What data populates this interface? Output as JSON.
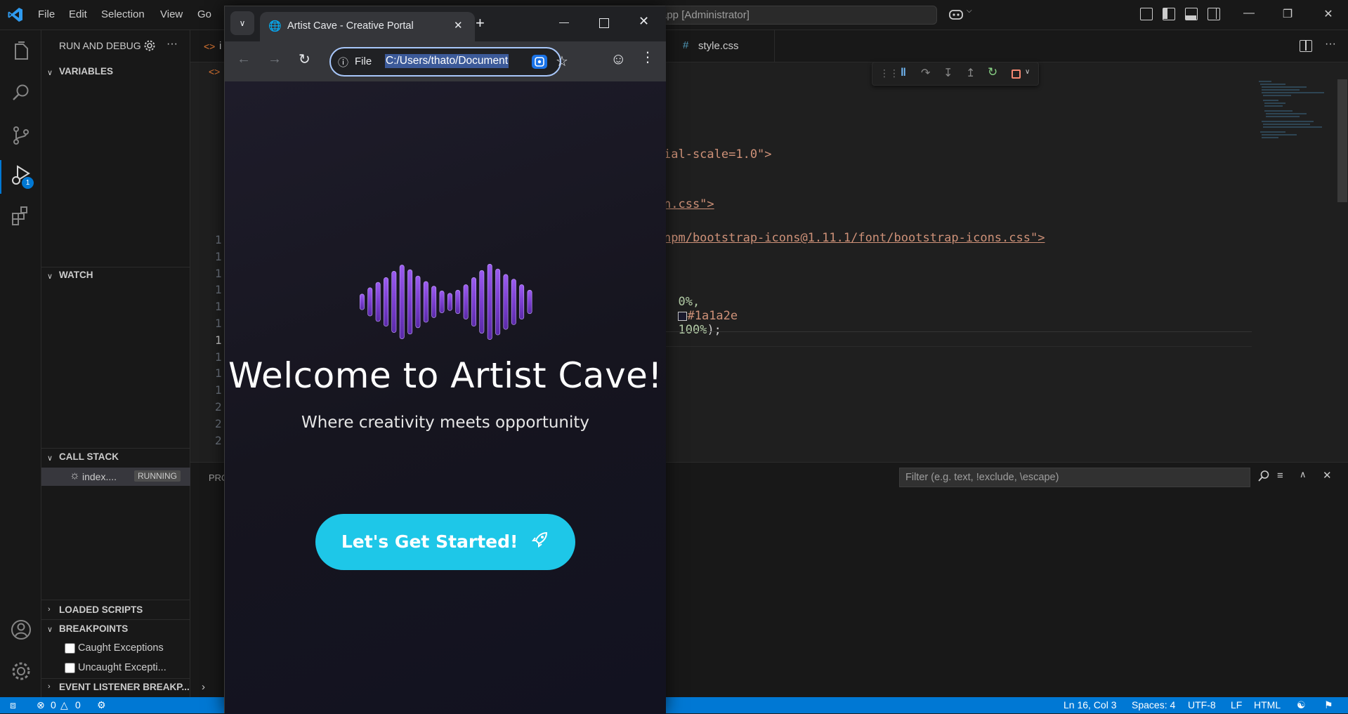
{
  "titlebar": {
    "menu": [
      "File",
      "Edit",
      "Selection",
      "View",
      "Go"
    ],
    "command_center": "app [Administrator]"
  },
  "activity": {
    "debug_badge": "1"
  },
  "sidebar": {
    "header": "RUN AND DEBUG",
    "variables": "VARIABLES",
    "watch": "WATCH",
    "call_stack": "CALL STACK",
    "call_stack_item": "index....",
    "call_stack_status": "RUNNING",
    "loaded_scripts": "LOADED SCRIPTS",
    "breakpoints": "BREAKPOINTS",
    "bp_caught": "Caught Exceptions",
    "bp_uncaught": "Uncaught Excepti...",
    "event_listener": "EVENT LISTENER BREAKP..."
  },
  "editor": {
    "tab_left": "i",
    "tab_style": "style.css",
    "line_numbers": [
      "1",
      "1",
      "1",
      "1",
      "1",
      "1",
      "1",
      "1",
      "1",
      "1",
      "2",
      "2",
      "2"
    ],
    "code": {
      "line_scale": "ial-scale=1.0\">",
      "line_css": "n.css\">",
      "line_icons": "npm/bootstrap-icons@1.11.1/font/bootstrap-icons.css\">",
      "line_gradient_a": "0%,",
      "line_gradient_b": "#1a1a2e",
      "line_gradient_c": "100%",
      "line_gradient_d": ");"
    }
  },
  "panel": {
    "tab_label": "PRO",
    "filter_placeholder": "Filter (e.g. text, !exclude, \\escape)"
  },
  "statusbar": {
    "errors": "0",
    "warnings": "0",
    "position": "Ln 16, Col 3",
    "spaces": "Spaces: 4",
    "encoding": "UTF-8",
    "eol": "LF",
    "language": "HTML"
  },
  "browser": {
    "tab_title": "Artist Cave - Creative Portal",
    "omnibox_scheme": "File",
    "omnibox_url": "C:/Users/thato/Document",
    "welcome": "Welcome to Artist Cave!",
    "tagline": "Where creativity meets opportunity",
    "cta": "Let's Get Started!",
    "wave_levels": [
      0.2,
      0.36,
      0.5,
      0.62,
      0.78,
      0.94,
      0.82,
      0.66,
      0.52,
      0.4,
      0.28,
      0.22,
      0.3,
      0.44,
      0.62,
      0.8,
      0.96,
      0.84,
      0.7,
      0.58,
      0.44,
      0.3
    ],
    "colors": {
      "cta": "#1ec7e8",
      "wave": "#7b3fd0"
    }
  }
}
